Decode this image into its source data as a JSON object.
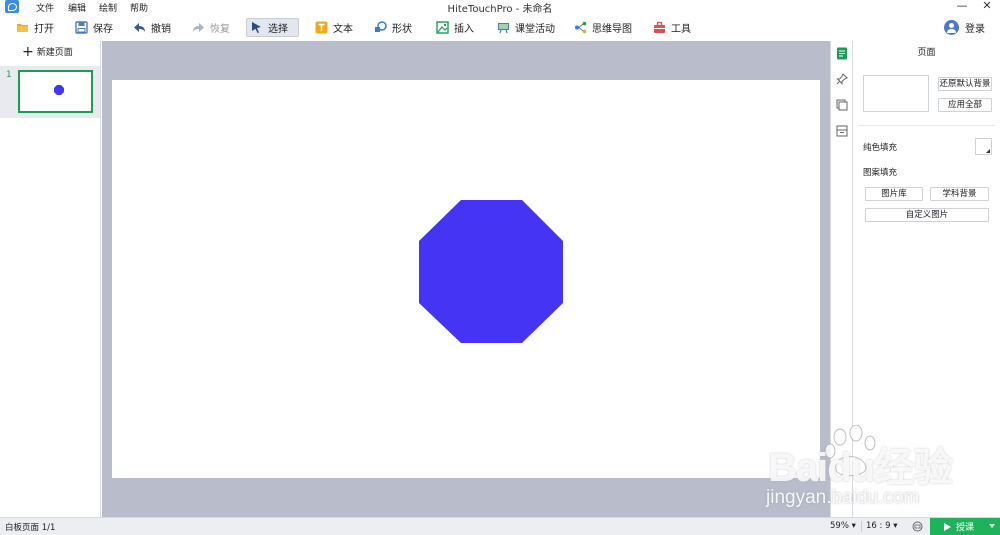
{
  "window": {
    "title": "HiteTouchPro - 未命名",
    "menus": [
      "文件",
      "编辑",
      "绘制",
      "帮助"
    ],
    "minimize": "—",
    "close": "✕"
  },
  "toolbar": {
    "open": "打开",
    "save": "保存",
    "undo": "撤销",
    "redo": "恢复",
    "select": "选择",
    "text": "文本",
    "shape": "形状",
    "insert": "插入",
    "class_activity": "课堂活动",
    "mindmap": "思维导图",
    "tools": "工具",
    "login": "登录"
  },
  "pages_panel": {
    "new_page": "新建页面",
    "pages": [
      {
        "number": "1"
      }
    ]
  },
  "canvas": {
    "shape": {
      "type": "octagon",
      "fill": "#4634f5"
    }
  },
  "properties": {
    "title": "页面",
    "reset_bg": "还原默认背景",
    "apply_all": "应用全部",
    "solid_fill": "纯色填充",
    "pattern_fill": "图案填充",
    "picture_lib": "图片库",
    "subject_bg": "学科背景",
    "custom_picture": "自定义图片"
  },
  "status": {
    "page_info": "白板页面 1/1",
    "zoom": "59%",
    "ratio": "16 : 9",
    "present": "授课"
  },
  "watermark": {
    "brand": "Baidu经验",
    "url": "jingyan.baidu.com"
  },
  "colors": {
    "accent_green": "#1db35a",
    "shape_fill": "#4634f5",
    "canvas_bg": "#b9bdcb"
  }
}
